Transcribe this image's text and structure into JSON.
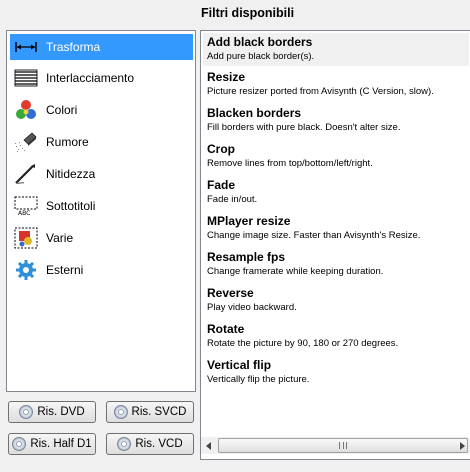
{
  "title": "Filtri disponibili",
  "categories": [
    {
      "label": "Trasforma",
      "icon": "transform-icon",
      "selected": true
    },
    {
      "label": "Interlacciamento",
      "icon": "interlace-icon",
      "selected": false
    },
    {
      "label": "Colori",
      "icon": "colors-icon",
      "selected": false
    },
    {
      "label": "Rumore",
      "icon": "noise-icon",
      "selected": false
    },
    {
      "label": "Nitidezza",
      "icon": "sharpness-icon",
      "selected": false
    },
    {
      "label": "Sottotitoli",
      "icon": "subtitles-icon",
      "selected": false
    },
    {
      "label": "Varie",
      "icon": "misc-icon",
      "selected": false
    },
    {
      "label": "Esterni",
      "icon": "external-gear-icon",
      "selected": false
    }
  ],
  "buttons": {
    "dvd": "Ris. DVD",
    "svcd": "Ris. SVCD",
    "halfd1": "Ris. Half D1",
    "vcd": "Ris. VCD"
  },
  "filters": [
    {
      "name": "Add black borders",
      "desc": "Add pure black border(s).",
      "selected": true
    },
    {
      "name": "Resize",
      "desc": "Picture resizer ported from Avisynth (C Version, slow).",
      "selected": false
    },
    {
      "name": "Blacken borders",
      "desc": "Fill borders with pure black. Doesn't alter size.",
      "selected": false
    },
    {
      "name": "Crop",
      "desc": "Remove lines from top/bottom/left/right.",
      "selected": false
    },
    {
      "name": "Fade",
      "desc": "Fade in/out.",
      "selected": false
    },
    {
      "name": "MPlayer resize",
      "desc": "Change image size. Faster than Avisynth's Resize.",
      "selected": false
    },
    {
      "name": "Resample fps",
      "desc": "Change framerate while keeping duration.",
      "selected": false
    },
    {
      "name": "Reverse",
      "desc": "Play video backward.",
      "selected": false
    },
    {
      "name": "Rotate",
      "desc": "Rotate the picture by 90, 180 or 270 degrees.",
      "selected": false
    },
    {
      "name": "Vertical flip",
      "desc": "Vertically flip the picture.",
      "selected": false
    }
  ],
  "colors": {
    "selection": "#3399ff",
    "border": "#828790"
  }
}
